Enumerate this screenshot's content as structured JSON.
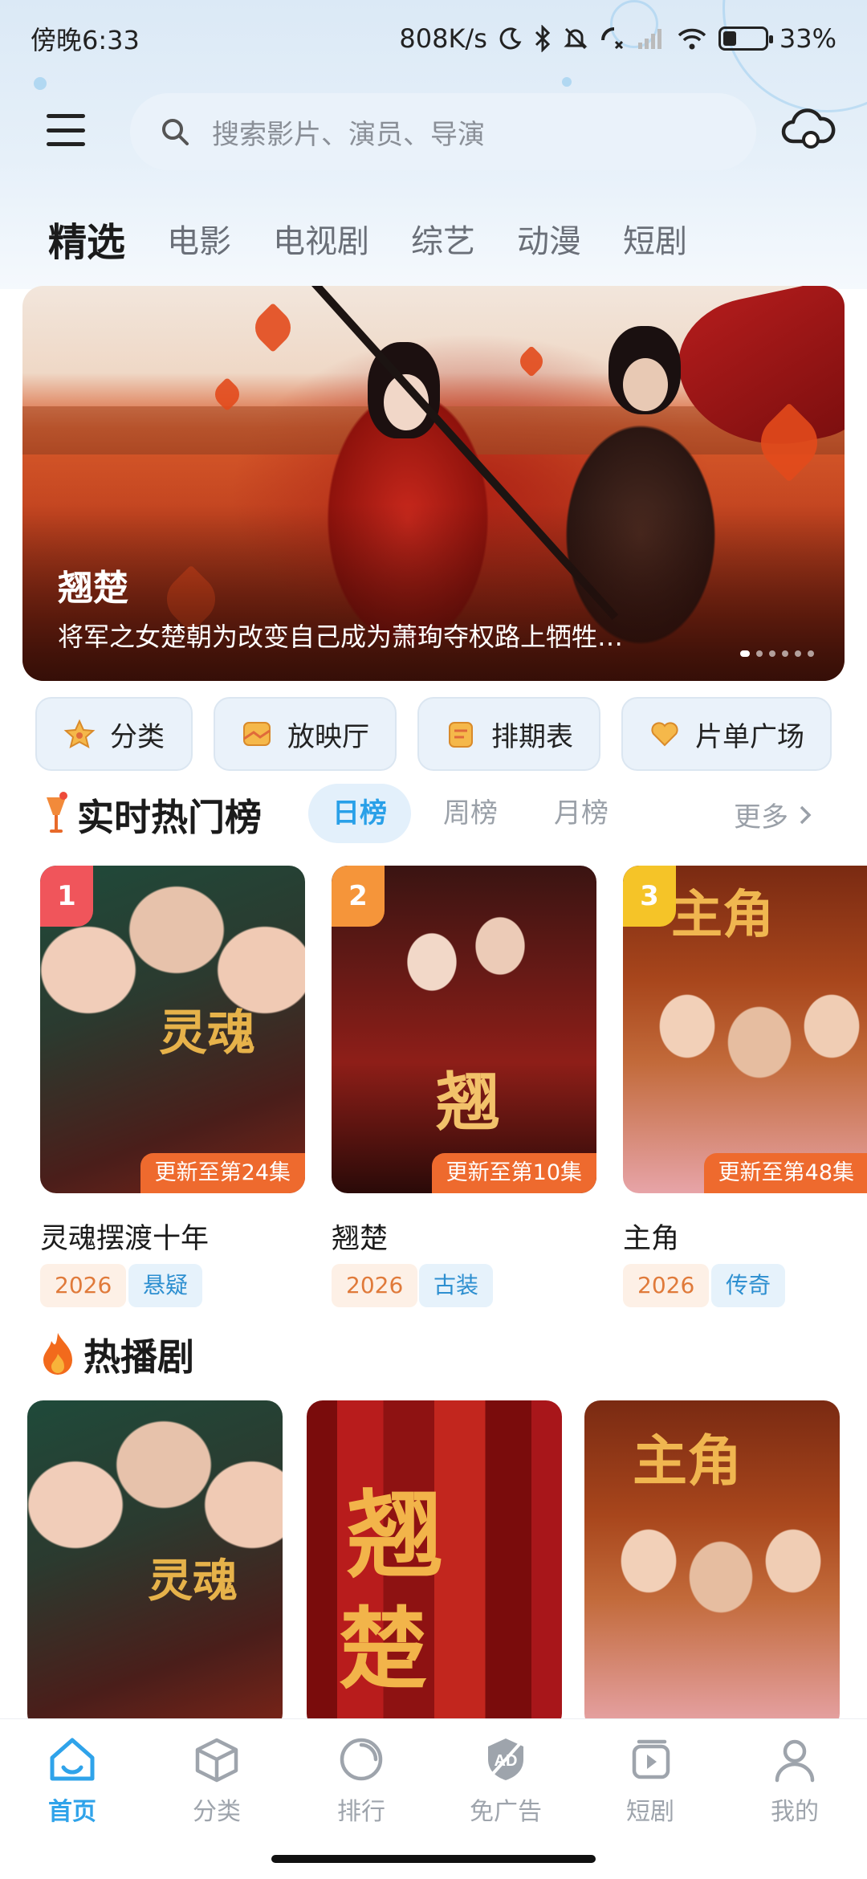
{
  "status_bar": {
    "time": "傍晚6:33",
    "net_speed": "808K/s",
    "battery_pct": "33%",
    "battery_level": 0.33
  },
  "search": {
    "placeholder": "搜索影片、演员、导演"
  },
  "category_tabs": [
    {
      "label": "精选",
      "active": true
    },
    {
      "label": "电影",
      "active": false
    },
    {
      "label": "电视剧",
      "active": false
    },
    {
      "label": "综艺",
      "active": false
    },
    {
      "label": "动漫",
      "active": false
    },
    {
      "label": "短剧",
      "active": false
    }
  ],
  "banner": {
    "title": "翘楚",
    "description": "将军之女楚朝为改变自己成为萧珣夺权路上牺牲…",
    "slide_count": 6,
    "active_slide": 0
  },
  "quick_entries": [
    {
      "label": "分类",
      "icon": "star-icon"
    },
    {
      "label": "放映厅",
      "icon": "screening-room-icon"
    },
    {
      "label": "排期表",
      "icon": "schedule-icon"
    },
    {
      "label": "片单广场",
      "icon": "heart-icon"
    }
  ],
  "hot_list": {
    "title": "实时热门榜",
    "tabs": [
      {
        "label": "日榜",
        "active": true
      },
      {
        "label": "周榜",
        "active": false
      },
      {
        "label": "月榜",
        "active": false
      }
    ],
    "more_label": "更多",
    "items": [
      {
        "rank": "1",
        "title": "灵魂摆渡十年",
        "episode": "更新至第24集",
        "year": "2026",
        "genre": "悬疑",
        "badge_color": "#f0555b"
      },
      {
        "rank": "2",
        "title": "翘楚",
        "episode": "更新至第10集",
        "year": "2026",
        "genre": "古装",
        "badge_color": "#f5953a"
      },
      {
        "rank": "3",
        "title": "主角",
        "episode": "更新至第48集",
        "year": "2026",
        "genre": "传奇",
        "badge_color": "#f5c428"
      }
    ]
  },
  "hot_drama": {
    "title": "热播剧"
  },
  "bottom_nav": [
    {
      "label": "首页",
      "icon": "home-icon",
      "active": true
    },
    {
      "label": "分类",
      "icon": "cube-icon",
      "active": false
    },
    {
      "label": "排行",
      "icon": "ranking-icon",
      "active": false
    },
    {
      "label": "免广告",
      "icon": "ad-free-icon",
      "active": false
    },
    {
      "label": "短剧",
      "icon": "short-drama-icon",
      "active": false
    },
    {
      "label": "我的",
      "icon": "profile-icon",
      "active": false
    }
  ]
}
